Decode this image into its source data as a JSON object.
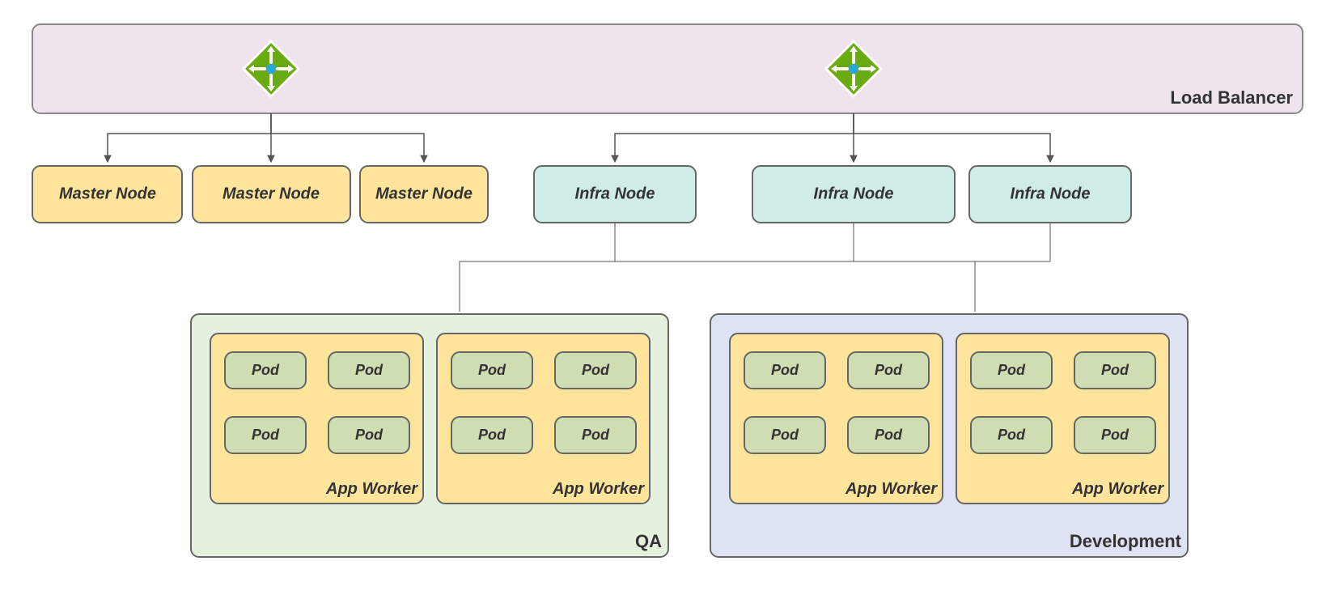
{
  "loadBalancer": {
    "label": "Load Balancer"
  },
  "masters": [
    "Master Node",
    "Master Node",
    "Master Node"
  ],
  "infras": [
    "Infra Node",
    "Infra Node",
    "Infra Node"
  ],
  "environments": {
    "qa": {
      "label": "QA",
      "workers": [
        {
          "label": "App Worker",
          "pods": [
            "Pod",
            "Pod",
            "Pod",
            "Pod"
          ]
        },
        {
          "label": "App Worker",
          "pods": [
            "Pod",
            "Pod",
            "Pod",
            "Pod"
          ]
        }
      ]
    },
    "dev": {
      "label": "Development",
      "workers": [
        {
          "label": "App Worker",
          "pods": [
            "Pod",
            "Pod",
            "Pod",
            "Pod"
          ]
        },
        {
          "label": "App Worker",
          "pods": [
            "Pod",
            "Pod",
            "Pod",
            "Pod"
          ]
        }
      ]
    }
  },
  "icon": "load-balancer-icon"
}
